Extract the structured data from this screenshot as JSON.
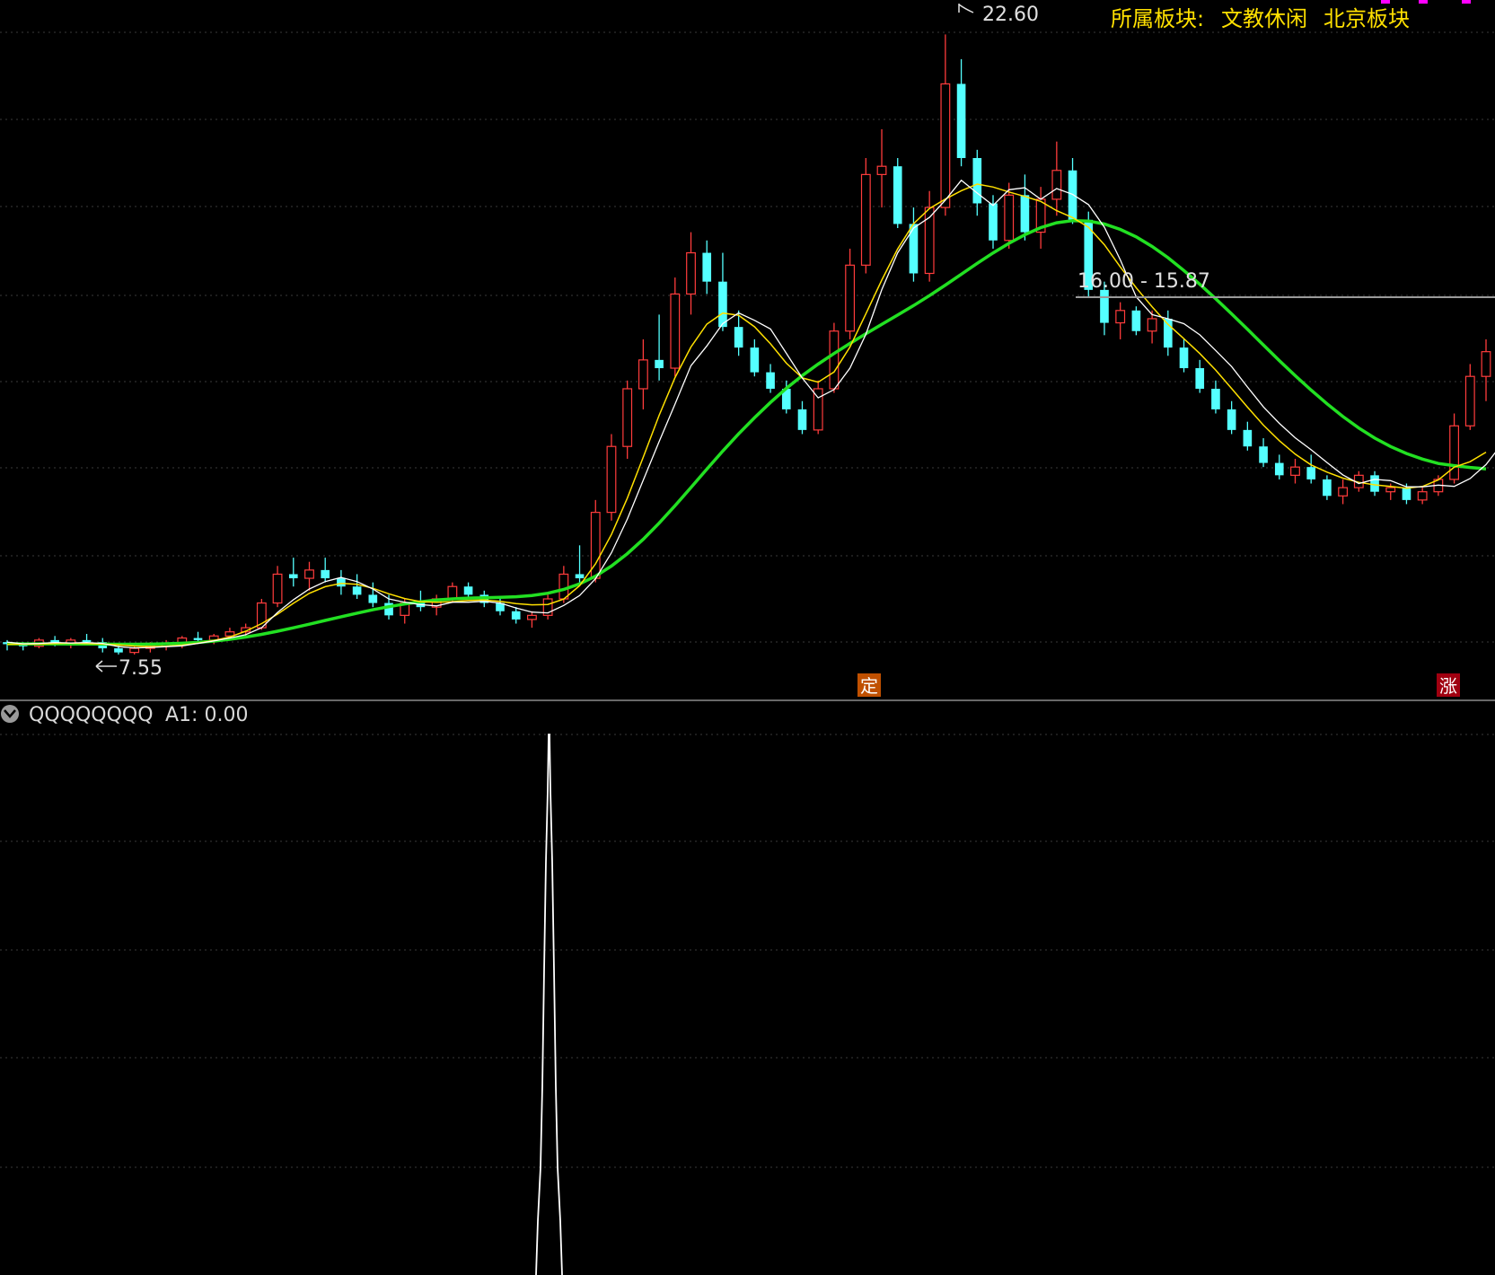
{
  "header": {
    "sector_label": "所属板块:",
    "sector_1": "文教休闲",
    "sector_2": "北京板块"
  },
  "annotations": {
    "high_label": "22.60",
    "low_label": "7.55",
    "range_label": "16.00 - 15.87",
    "marker_ding": "定",
    "marker_zhang": "涨"
  },
  "indicator": {
    "name": "QQQQQQQQ",
    "value_label": "A1: 0.00"
  },
  "colors": {
    "background": "#000000",
    "up": "#ff3c3c",
    "down": "#54ffff",
    "ma_white": "#ffffff",
    "ma_yellow": "#ffe000",
    "ma_green": "#22e022",
    "header_text": "#ffe000",
    "marker_ding_bg": "#c05000",
    "marker_zhang_bg": "#a00010"
  },
  "chart_data": {
    "type": "candlestick",
    "price_range": [
      7.2,
      23.0
    ],
    "high": 22.6,
    "low": 7.55,
    "ohlc": [
      [
        7.85,
        7.9,
        7.65,
        7.8
      ],
      [
        7.8,
        7.85,
        7.65,
        7.75
      ],
      [
        7.75,
        7.95,
        7.7,
        7.9
      ],
      [
        7.9,
        8.0,
        7.75,
        7.8
      ],
      [
        7.8,
        7.95,
        7.7,
        7.9
      ],
      [
        7.9,
        8.05,
        7.8,
        7.85
      ],
      [
        7.85,
        7.95,
        7.6,
        7.7
      ],
      [
        7.7,
        7.8,
        7.55,
        7.6
      ],
      [
        7.6,
        7.75,
        7.55,
        7.7
      ],
      [
        7.7,
        7.85,
        7.6,
        7.75
      ],
      [
        7.75,
        7.9,
        7.65,
        7.8
      ],
      [
        7.8,
        8.0,
        7.7,
        7.95
      ],
      [
        7.95,
        8.1,
        7.85,
        7.9
      ],
      [
        7.9,
        8.05,
        7.8,
        8.0
      ],
      [
        8.0,
        8.2,
        7.9,
        8.1
      ],
      [
        8.1,
        8.3,
        8.0,
        8.2
      ],
      [
        8.2,
        8.9,
        8.15,
        8.8
      ],
      [
        8.8,
        9.7,
        8.7,
        9.5
      ],
      [
        9.5,
        9.9,
        9.2,
        9.4
      ],
      [
        9.4,
        9.8,
        9.1,
        9.6
      ],
      [
        9.6,
        9.9,
        9.3,
        9.4
      ],
      [
        9.4,
        9.6,
        9.0,
        9.2
      ],
      [
        9.2,
        9.5,
        8.9,
        9.0
      ],
      [
        9.0,
        9.3,
        8.7,
        8.8
      ],
      [
        8.8,
        9.0,
        8.4,
        8.5
      ],
      [
        8.5,
        8.9,
        8.3,
        8.8
      ],
      [
        8.8,
        9.1,
        8.6,
        8.7
      ],
      [
        8.7,
        9.0,
        8.5,
        8.9
      ],
      [
        8.9,
        9.3,
        8.8,
        9.2
      ],
      [
        9.2,
        9.3,
        8.9,
        9.0
      ],
      [
        9.0,
        9.1,
        8.7,
        8.8
      ],
      [
        8.8,
        8.9,
        8.5,
        8.6
      ],
      [
        8.6,
        8.7,
        8.3,
        8.4
      ],
      [
        8.4,
        8.6,
        8.2,
        8.5
      ],
      [
        8.5,
        9.0,
        8.4,
        8.9
      ],
      [
        8.9,
        9.7,
        8.8,
        9.5
      ],
      [
        9.5,
        10.2,
        9.3,
        9.4
      ],
      [
        9.4,
        11.3,
        9.3,
        11.0
      ],
      [
        11.0,
        12.9,
        10.8,
        12.6
      ],
      [
        12.6,
        14.2,
        12.3,
        14.0
      ],
      [
        14.0,
        15.2,
        13.5,
        14.7
      ],
      [
        14.7,
        15.8,
        14.2,
        14.5
      ],
      [
        14.5,
        16.7,
        14.3,
        16.3
      ],
      [
        16.3,
        17.8,
        15.8,
        17.3
      ],
      [
        17.3,
        17.6,
        16.3,
        16.6
      ],
      [
        16.6,
        17.3,
        15.4,
        15.5
      ],
      [
        15.5,
        15.9,
        14.8,
        15.0
      ],
      [
        15.0,
        15.2,
        14.3,
        14.4
      ],
      [
        14.4,
        14.6,
        13.9,
        14.0
      ],
      [
        14.0,
        14.2,
        13.4,
        13.5
      ],
      [
        13.5,
        13.7,
        12.9,
        13.0
      ],
      [
        13.0,
        14.2,
        12.9,
        14.0
      ],
      [
        14.0,
        15.6,
        13.9,
        15.4
      ],
      [
        15.4,
        17.4,
        15.2,
        17.0
      ],
      [
        17.0,
        19.6,
        16.8,
        19.2
      ],
      [
        19.2,
        20.3,
        18.4,
        19.4
      ],
      [
        19.4,
        19.6,
        17.9,
        18.0
      ],
      [
        18.0,
        18.4,
        16.6,
        16.8
      ],
      [
        16.8,
        18.8,
        16.6,
        18.4
      ],
      [
        18.4,
        22.6,
        18.2,
        21.4
      ],
      [
        21.4,
        22.0,
        19.4,
        19.6
      ],
      [
        19.6,
        19.8,
        18.2,
        18.5
      ],
      [
        18.5,
        18.7,
        17.4,
        17.6
      ],
      [
        17.6,
        19.0,
        17.4,
        18.7
      ],
      [
        18.7,
        19.2,
        17.6,
        17.8
      ],
      [
        17.8,
        18.9,
        17.4,
        18.6
      ],
      [
        18.6,
        20.0,
        18.2,
        19.3
      ],
      [
        19.3,
        19.6,
        18.0,
        18.1
      ],
      [
        18.1,
        18.3,
        16.2,
        16.4
      ],
      [
        16.4,
        16.6,
        15.3,
        15.6
      ],
      [
        15.6,
        16.1,
        15.2,
        15.9
      ],
      [
        15.9,
        16.0,
        15.3,
        15.4
      ],
      [
        15.4,
        15.9,
        15.1,
        15.7
      ],
      [
        15.7,
        15.9,
        14.8,
        15.0
      ],
      [
        15.0,
        15.2,
        14.4,
        14.5
      ],
      [
        14.5,
        14.7,
        13.9,
        14.0
      ],
      [
        14.0,
        14.2,
        13.4,
        13.5
      ],
      [
        13.5,
        13.7,
        12.9,
        13.0
      ],
      [
        13.0,
        13.2,
        12.5,
        12.6
      ],
      [
        12.6,
        12.8,
        12.1,
        12.2
      ],
      [
        12.2,
        12.4,
        11.8,
        11.9
      ],
      [
        11.9,
        12.3,
        11.7,
        12.1
      ],
      [
        12.1,
        12.4,
        11.7,
        11.8
      ],
      [
        11.8,
        11.9,
        11.3,
        11.4
      ],
      [
        11.4,
        11.8,
        11.2,
        11.6
      ],
      [
        11.6,
        12.0,
        11.5,
        11.9
      ],
      [
        11.9,
        12.0,
        11.4,
        11.5
      ],
      [
        11.5,
        11.7,
        11.3,
        11.6
      ],
      [
        11.6,
        11.7,
        11.2,
        11.3
      ],
      [
        11.3,
        11.6,
        11.2,
        11.5
      ],
      [
        11.5,
        11.9,
        11.4,
        11.8
      ],
      [
        11.8,
        13.4,
        11.7,
        13.1
      ],
      [
        13.1,
        14.6,
        13.0,
        14.3
      ],
      [
        14.3,
        15.2,
        13.7,
        14.9
      ]
    ],
    "ma_white": [
      7.85,
      7.81,
      7.82,
      7.84,
      7.83,
      7.84,
      7.82,
      7.74,
      7.71,
      7.72,
      7.74,
      7.76,
      7.82,
      7.88,
      7.95,
      8.03,
      8.2,
      8.57,
      8.88,
      9.14,
      9.32,
      9.42,
      9.32,
      9.14,
      8.9,
      8.82,
      8.76,
      8.73,
      8.82,
      8.82,
      8.84,
      8.8,
      8.68,
      8.58,
      8.56,
      8.74,
      8.98,
      9.39,
      10.02,
      10.84,
      11.78,
      12.72,
      13.63,
      14.56,
      15.04,
      15.58,
      15.84,
      15.66,
      15.45,
      14.86,
      14.26,
      13.78,
      13.98,
      14.5,
      15.32,
      16.4,
      17.3,
      17.9,
      18.16,
      18.58,
      19.06,
      18.75,
      18.45,
      18.83,
      18.88,
      18.6,
      18.86,
      18.72,
      18.47,
      17.92,
      17.13,
      16.23,
      15.8,
      15.7,
      15.58,
      15.31,
      14.93,
      14.54,
      14.04,
      13.56,
      13.16,
      12.81,
      12.52,
      12.21,
      11.91,
      11.7,
      11.8,
      11.77,
      11.62,
      11.62,
      11.66,
      11.63,
      11.82,
      12.16,
      12.66
    ]
  }
}
